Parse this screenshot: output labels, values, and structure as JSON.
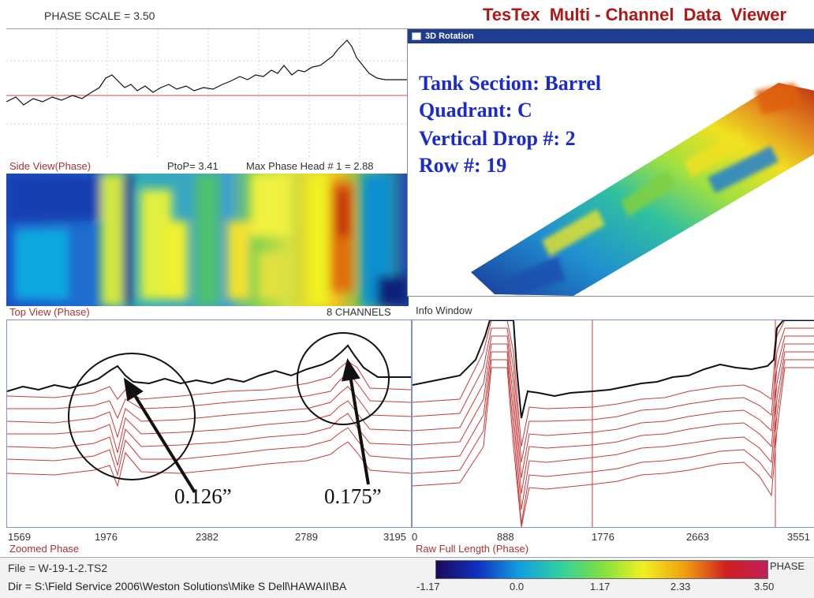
{
  "header": {
    "phase_scale": "PHASE SCALE = 3.50",
    "app_title": "TesTex  Multi - Channel  Data  Viewer"
  },
  "side_view": {
    "label": "Side View(Phase)",
    "ptop": "PtoP= 3.41",
    "max_phase": "Max Phase Head # 1 = 2.88"
  },
  "top_view": {
    "label": "Top View (Phase)",
    "channels": "8 CHANNELS"
  },
  "rotation_window": {
    "title": "3D Rotation",
    "overlay": {
      "tank_section": "Tank Section: Barrel",
      "quadrant": "Quadrant: C",
      "vertical_drop": "Vertical Drop #: 2",
      "row": "Row #: 19"
    }
  },
  "info_window": {
    "label": "Info Window"
  },
  "zoomed_phase": {
    "label": "Zoomed Phase",
    "ticks": [
      "1569",
      "1976",
      "2382",
      "2789",
      "3195"
    ],
    "annotations": [
      "0.126”",
      "0.175”"
    ]
  },
  "raw_full_length": {
    "label": "Raw Full Length (Phase)",
    "ticks": [
      "0",
      "888",
      "1776",
      "2663",
      "3551"
    ]
  },
  "status": {
    "file": "File = W-19-1-2.TS2",
    "dir": "Dir = S:\\Field Service 2006\\Weston Solutions\\Mike S Dell\\HAWAII\\BA"
  },
  "colorbar": {
    "label": "PHASE",
    "ticks": [
      "-1.17",
      "0.0",
      "1.17",
      "2.33",
      "3.50"
    ],
    "colors": [
      "#1a0a5a",
      "#1030c0",
      "#10a0e0",
      "#30d0a0",
      "#80e040",
      "#f0f020",
      "#f0a010",
      "#d02020",
      "#c0205a"
    ]
  },
  "colors": {
    "trace_black": "#111111",
    "trace_red": "#c83a3a",
    "panel_border": "#7c8fd8"
  }
}
